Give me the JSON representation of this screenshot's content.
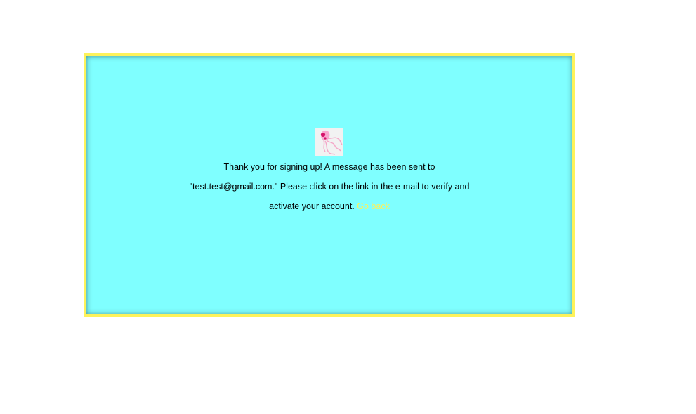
{
  "colors": {
    "panel_background": "#7fffff",
    "panel_border": "#fdf25a",
    "link": "#fdf25a",
    "logo_background": "#f2f2f2"
  },
  "logo": {
    "icon": "jellyfish-icon"
  },
  "message": {
    "text": "Thank you for signing up! A message has been sent to \"test.test@gmail.com.\" Please click on the link in the e-mail to verify and activate your account.",
    "link_label": "Go back"
  }
}
